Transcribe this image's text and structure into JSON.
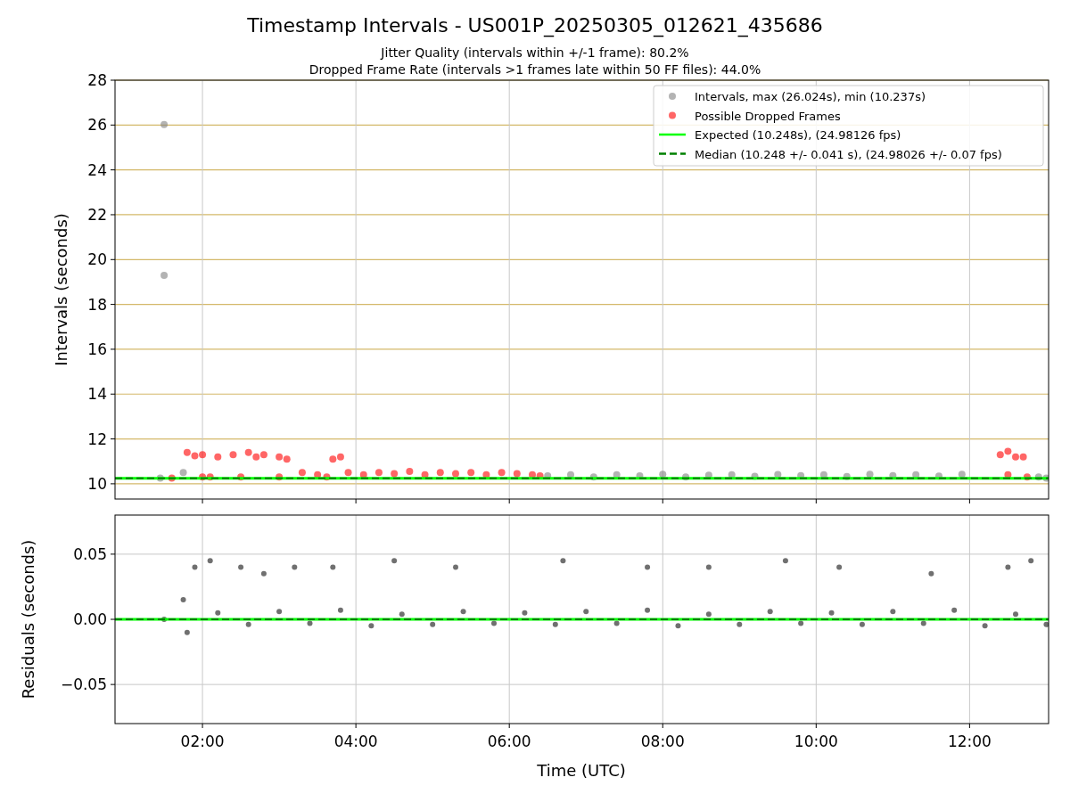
{
  "figure": {
    "title": "Timestamp Intervals - US001P_20250305_012621_435686",
    "subtitles": [
      "Jitter Quality (intervals within +/-1 frame): 80.2%",
      "Dropped Frame Rate (intervals >1 frames late within 50 FF files): 44.0%"
    ],
    "top_chart": {
      "chart_data": {
        "type": "scatter",
        "ylabel": "Intervals (seconds)",
        "xlim": [
          0.86,
          13.03
        ],
        "ylim": [
          9.32,
          28
        ],
        "grid": true,
        "legend": "upper right",
        "yticks": [
          {
            "value": 10,
            "label": "10"
          },
          {
            "value": 12,
            "label": "12"
          },
          {
            "value": 14,
            "label": "14"
          },
          {
            "value": 16,
            "label": "16"
          },
          {
            "value": 18,
            "label": "18"
          },
          {
            "value": 20,
            "label": "20"
          },
          {
            "value": 22,
            "label": "22"
          },
          {
            "value": 24,
            "label": "24"
          },
          {
            "value": 26,
            "label": "26"
          },
          {
            "value": 28,
            "label": "28"
          }
        ],
        "series": [
          {
            "name": "Intervals, max (26.024s), min (10.237s)",
            "color": "#808080",
            "x": [
              1.5,
              1.5,
              1.45,
              1.75,
              6.5,
              6.8,
              7.1,
              7.4,
              7.7,
              8.0,
              8.3,
              8.6,
              8.9,
              9.2,
              9.5,
              9.8,
              10.1,
              10.4,
              10.7,
              11.0,
              11.3,
              11.6,
              11.9,
              12.9,
              13.0
            ],
            "values": [
              26.02,
              19.3,
              10.25,
              10.5,
              10.35,
              10.4,
              10.3,
              10.4,
              10.35,
              10.42,
              10.3,
              10.38,
              10.4,
              10.33,
              10.41,
              10.36,
              10.4,
              10.32,
              10.42,
              10.36,
              10.4,
              10.34,
              10.42,
              10.3,
              10.25
            ]
          },
          {
            "name": "Possible Dropped Frames",
            "color": "#ff0000",
            "x": [
              1.6,
              1.8,
              1.9,
              2.0,
              2.1,
              2.2,
              2.4,
              2.6,
              2.7,
              2.8,
              3.0,
              3.1,
              3.3,
              3.5,
              3.7,
              3.8,
              3.9,
              4.1,
              4.3,
              4.5,
              4.7,
              4.9,
              5.1,
              5.3,
              5.5,
              5.7,
              5.9,
              6.1,
              6.3,
              6.4,
              2.0,
              2.5,
              3.0,
              3.62,
              12.4,
              12.5,
              12.6,
              12.7,
              12.5,
              12.75
            ],
            "values": [
              10.25,
              11.4,
              11.25,
              11.3,
              10.3,
              11.2,
              11.3,
              11.4,
              11.2,
              11.3,
              11.2,
              11.1,
              10.5,
              10.4,
              11.1,
              11.2,
              10.5,
              10.4,
              10.5,
              10.45,
              10.55,
              10.4,
              10.5,
              10.45,
              10.5,
              10.4,
              10.5,
              10.45,
              10.4,
              10.35,
              10.3,
              10.3,
              10.3,
              10.3,
              11.3,
              11.45,
              11.2,
              11.2,
              10.4,
              10.3
            ]
          }
        ],
        "ref_lines": [
          {
            "axis": "y",
            "value": 10.248,
            "label": "Expected (10.248s), (24.98126 fps)",
            "color": "#00ff00"
          },
          {
            "axis": "y",
            "value": 10.248,
            "label": "Median (10.248 +/- 0.041 s), (24.98026 +/- 0.07 fps)",
            "color": "#008000"
          }
        ]
      }
    },
    "bottom_chart": {
      "chart_data": {
        "type": "scatter",
        "xlabel": "Time (UTC)",
        "ylabel": "Residuals (seconds)",
        "xlim": [
          0.86,
          13.03
        ],
        "ylim": [
          -0.08,
          0.08
        ],
        "grid": true,
        "xticks": [
          {
            "value": 2,
            "label": "02:00"
          },
          {
            "value": 4,
            "label": "04:00"
          },
          {
            "value": 6,
            "label": "06:00"
          },
          {
            "value": 8,
            "label": "08:00"
          },
          {
            "value": 10,
            "label": "10:00"
          },
          {
            "value": 12,
            "label": "12:00"
          }
        ],
        "yticks": [
          {
            "value": -0.05,
            "label": "−0.05"
          },
          {
            "value": 0,
            "label": "0.00"
          },
          {
            "value": 0.05,
            "label": "0.05"
          }
        ],
        "series": [
          {
            "color": "#707070",
            "x": [
              1.5,
              1.8,
              1.75,
              1.9,
              2.1,
              2.5,
              2.8,
              3.2,
              3.7,
              4.5,
              5.3,
              6.7,
              7.8,
              8.6,
              9.6,
              10.3,
              11.5,
              12.5,
              12.8,
              2.2,
              2.6,
              3.0,
              3.4,
              3.8,
              4.2,
              4.6,
              5.0,
              5.4,
              5.8,
              6.2,
              6.6,
              7.0,
              7.4,
              7.8,
              8.2,
              8.6,
              9.0,
              9.4,
              9.8,
              10.2,
              10.6,
              11.0,
              11.4,
              11.8,
              12.2,
              12.6,
              13.0
            ],
            "values": [
              0.0,
              -0.01,
              0.015,
              0.04,
              0.045,
              0.04,
              0.035,
              0.04,
              0.04,
              0.045,
              0.04,
              0.045,
              0.04,
              0.04,
              0.045,
              0.04,
              0.035,
              0.04,
              0.045,
              0.005,
              -0.004,
              0.006,
              -0.003,
              0.007,
              -0.005,
              0.004,
              -0.004,
              0.006,
              -0.003,
              0.005,
              -0.004,
              0.006,
              -0.003,
              0.007,
              -0.005,
              0.004,
              -0.004,
              0.006,
              -0.003,
              0.005,
              -0.004,
              0.006,
              -0.003,
              0.007,
              -0.005,
              0.004,
              -0.004
            ]
          }
        ],
        "ref_lines": [
          {
            "axis": "y",
            "value": 0,
            "color": "#00ff00"
          },
          {
            "axis": "y",
            "value": 0,
            "color": "#008000"
          }
        ]
      }
    }
  }
}
